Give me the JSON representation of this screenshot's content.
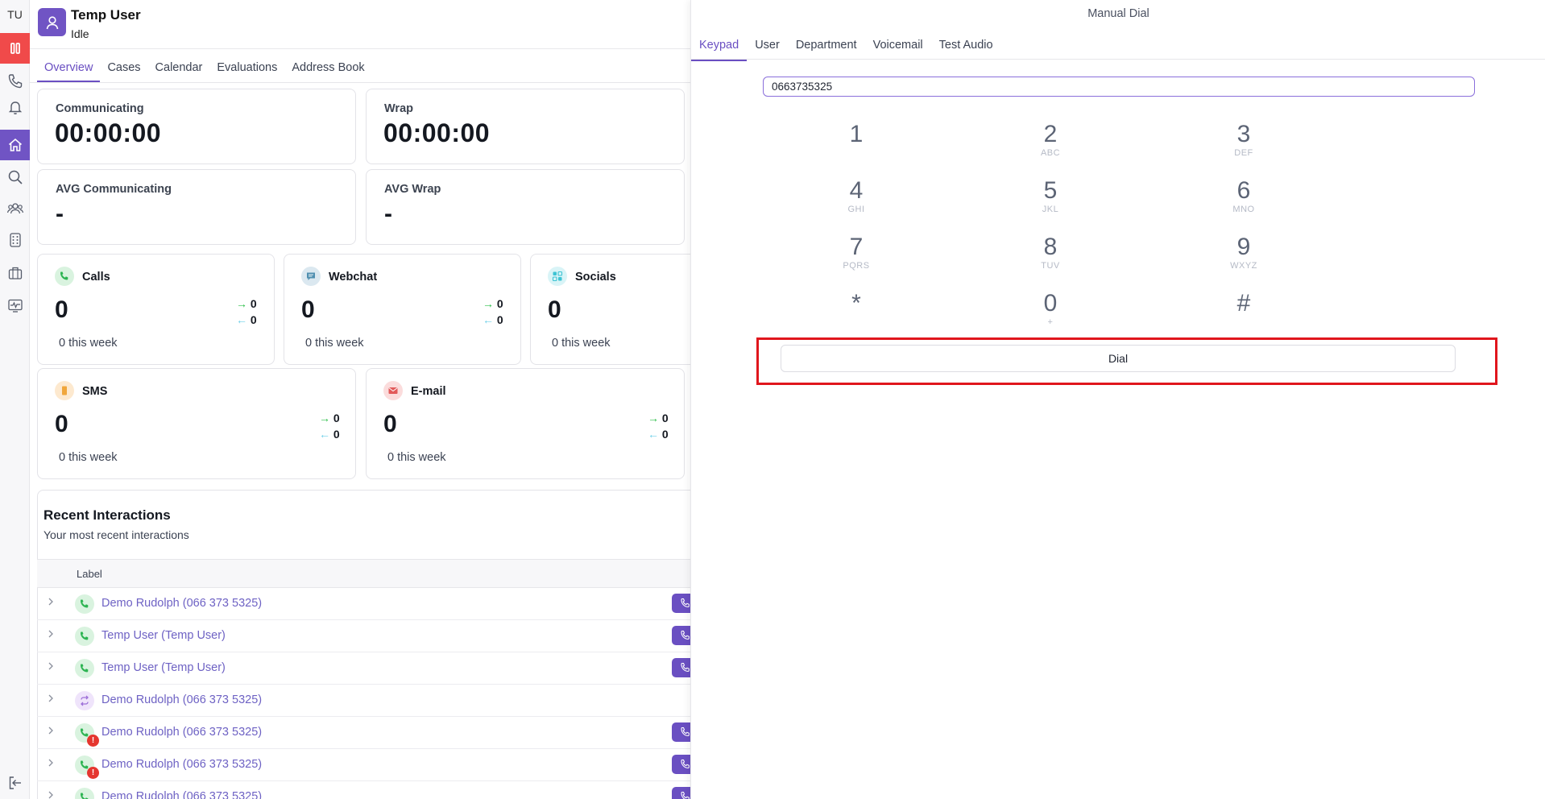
{
  "rail": {
    "initials": "TU",
    "icons": [
      "pause-icon",
      "phone-icon",
      "bell-icon",
      "home-icon",
      "search-icon",
      "users-icon",
      "keypad-icon",
      "briefcase-icon",
      "monitor-icon",
      "logout-icon"
    ]
  },
  "header": {
    "name": "Temp User",
    "status": "Idle"
  },
  "tabs": [
    "Overview",
    "Cases",
    "Calendar",
    "Evaluations",
    "Address Book"
  ],
  "stats": {
    "communicating": {
      "label": "Communicating",
      "value": "00:00:00"
    },
    "wrap": {
      "label": "Wrap",
      "value": "00:00:00"
    },
    "avg_communicating": {
      "label": "AVG Communicating",
      "value": "-"
    },
    "avg_wrap": {
      "label": "AVG Wrap",
      "value": "-"
    }
  },
  "media": {
    "calls": {
      "title": "Calls",
      "count": "0",
      "out": "0",
      "in": "0",
      "week": "0 this week",
      "color": "#d9f3df"
    },
    "webchat": {
      "title": "Webchat",
      "count": "0",
      "out": "0",
      "in": "0",
      "week": "0 this week",
      "color": "#dbe8f0"
    },
    "socials": {
      "title": "Socials",
      "count": "0",
      "week": "0 this week",
      "color": "#d9f4f7"
    },
    "sms": {
      "title": "SMS",
      "count": "0",
      "out": "0",
      "in": "0",
      "week": "0 this week",
      "color": "#fde9cf"
    },
    "email": {
      "title": "E-mail",
      "count": "0",
      "out": "0",
      "in": "0",
      "week": "0 this week",
      "color": "#fbdcdc"
    }
  },
  "arrows": {
    "out": "→",
    "in": "←"
  },
  "recent": {
    "title": "Recent Interactions",
    "subtitle": "Your most recent interactions",
    "column": "Label",
    "rows": [
      {
        "label": "Demo Rudolph (066 373 5325)",
        "type": "call",
        "alert": false,
        "callback": true
      },
      {
        "label": "Temp User (Temp User)",
        "type": "call",
        "alert": false,
        "callback": true
      },
      {
        "label": "Temp User (Temp User)",
        "type": "call",
        "alert": false,
        "callback": true
      },
      {
        "label": "Demo Rudolph (066 373 5325)",
        "type": "transfer",
        "alert": false,
        "callback": false
      },
      {
        "label": "Demo Rudolph (066 373 5325)",
        "type": "call",
        "alert": true,
        "callback": true
      },
      {
        "label": "Demo Rudolph (066 373 5325)",
        "type": "call",
        "alert": true,
        "callback": true
      },
      {
        "label": "Demo Rudolph (066 373 5325)",
        "type": "call",
        "alert": false,
        "callback": true
      }
    ],
    "alert_mark": "!"
  },
  "dial": {
    "title": "Manual Dial",
    "tabs": [
      "Keypad",
      "User",
      "Department",
      "Voicemail",
      "Test Audio"
    ],
    "number": "0663735325",
    "keys": [
      {
        "d": "1",
        "l": ""
      },
      {
        "d": "2",
        "l": "ABC"
      },
      {
        "d": "3",
        "l": "DEF"
      },
      {
        "d": "4",
        "l": "GHI"
      },
      {
        "d": "5",
        "l": "JKL"
      },
      {
        "d": "6",
        "l": "MNO"
      },
      {
        "d": "7",
        "l": "PQRS"
      },
      {
        "d": "8",
        "l": "TUV"
      },
      {
        "d": "9",
        "l": "WXYZ"
      },
      {
        "d": "*",
        "l": ""
      },
      {
        "d": "0",
        "l": "+"
      },
      {
        "d": "#",
        "l": ""
      }
    ],
    "button": "Dial"
  },
  "colors": {
    "accent": "#6a4fc2",
    "danger": "#e5362f",
    "pause": "#f04a4a"
  }
}
